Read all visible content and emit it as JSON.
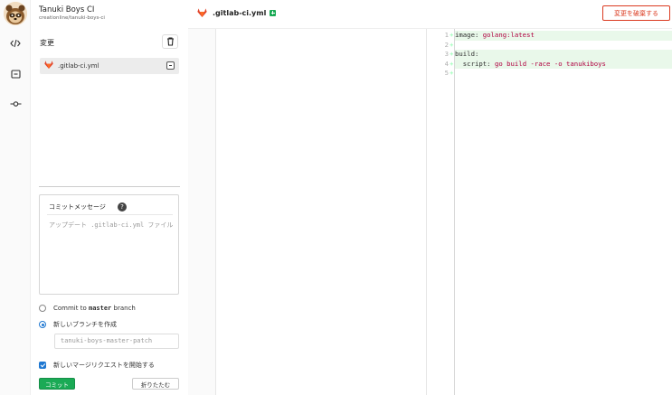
{
  "project": {
    "title": "Tanuki Boys CI",
    "path": "creationline/tanuki-boys-ci"
  },
  "rail": {
    "items": [
      {
        "icon": "code-icon"
      },
      {
        "icon": "review-icon"
      },
      {
        "icon": "commit-icon"
      }
    ]
  },
  "sidebar": {
    "changes_title": "変更",
    "files": [
      {
        "name": ".gitlab-ci.yml"
      }
    ]
  },
  "commit_form": {
    "message_label": "コミットメッセージ",
    "help_glyph": "?",
    "message_placeholder": "アップデート .gitlab-ci.yml ファイル",
    "option_commit_prefix": "Commit to",
    "option_commit_branch": "master",
    "option_commit_suffix": "branch",
    "option_new_branch": "新しいブランチを作成",
    "new_branch_name": "tanuki-boys-master-patch",
    "new_mr_label": "新しいマージリクエストを開始する",
    "commit_button": "コミット",
    "collapse_button": "折りたたむ",
    "selected_option": "new_branch",
    "new_mr_checked": true
  },
  "editor": {
    "tab_name": ".gitlab-ci.yml",
    "discard_button": "変更を破棄する",
    "lines": [
      {
        "n": "1",
        "sign": "+",
        "key": "image:",
        "value": " golang:latest"
      },
      {
        "n": "2",
        "sign": "+",
        "key": "",
        "value": ""
      },
      {
        "n": "3",
        "sign": "+",
        "key": "build:",
        "value": ""
      },
      {
        "n": "4",
        "sign": "+",
        "key": "  script:",
        "value": " go build -race -o tanukiboys"
      },
      {
        "n": "5",
        "sign": "+",
        "key": "",
        "value": ""
      }
    ]
  },
  "colors": {
    "accent": "#1f78d1",
    "commit_green": "#1aaa55",
    "danger": "#db3b21",
    "added_bg": "#e9f8ea"
  }
}
